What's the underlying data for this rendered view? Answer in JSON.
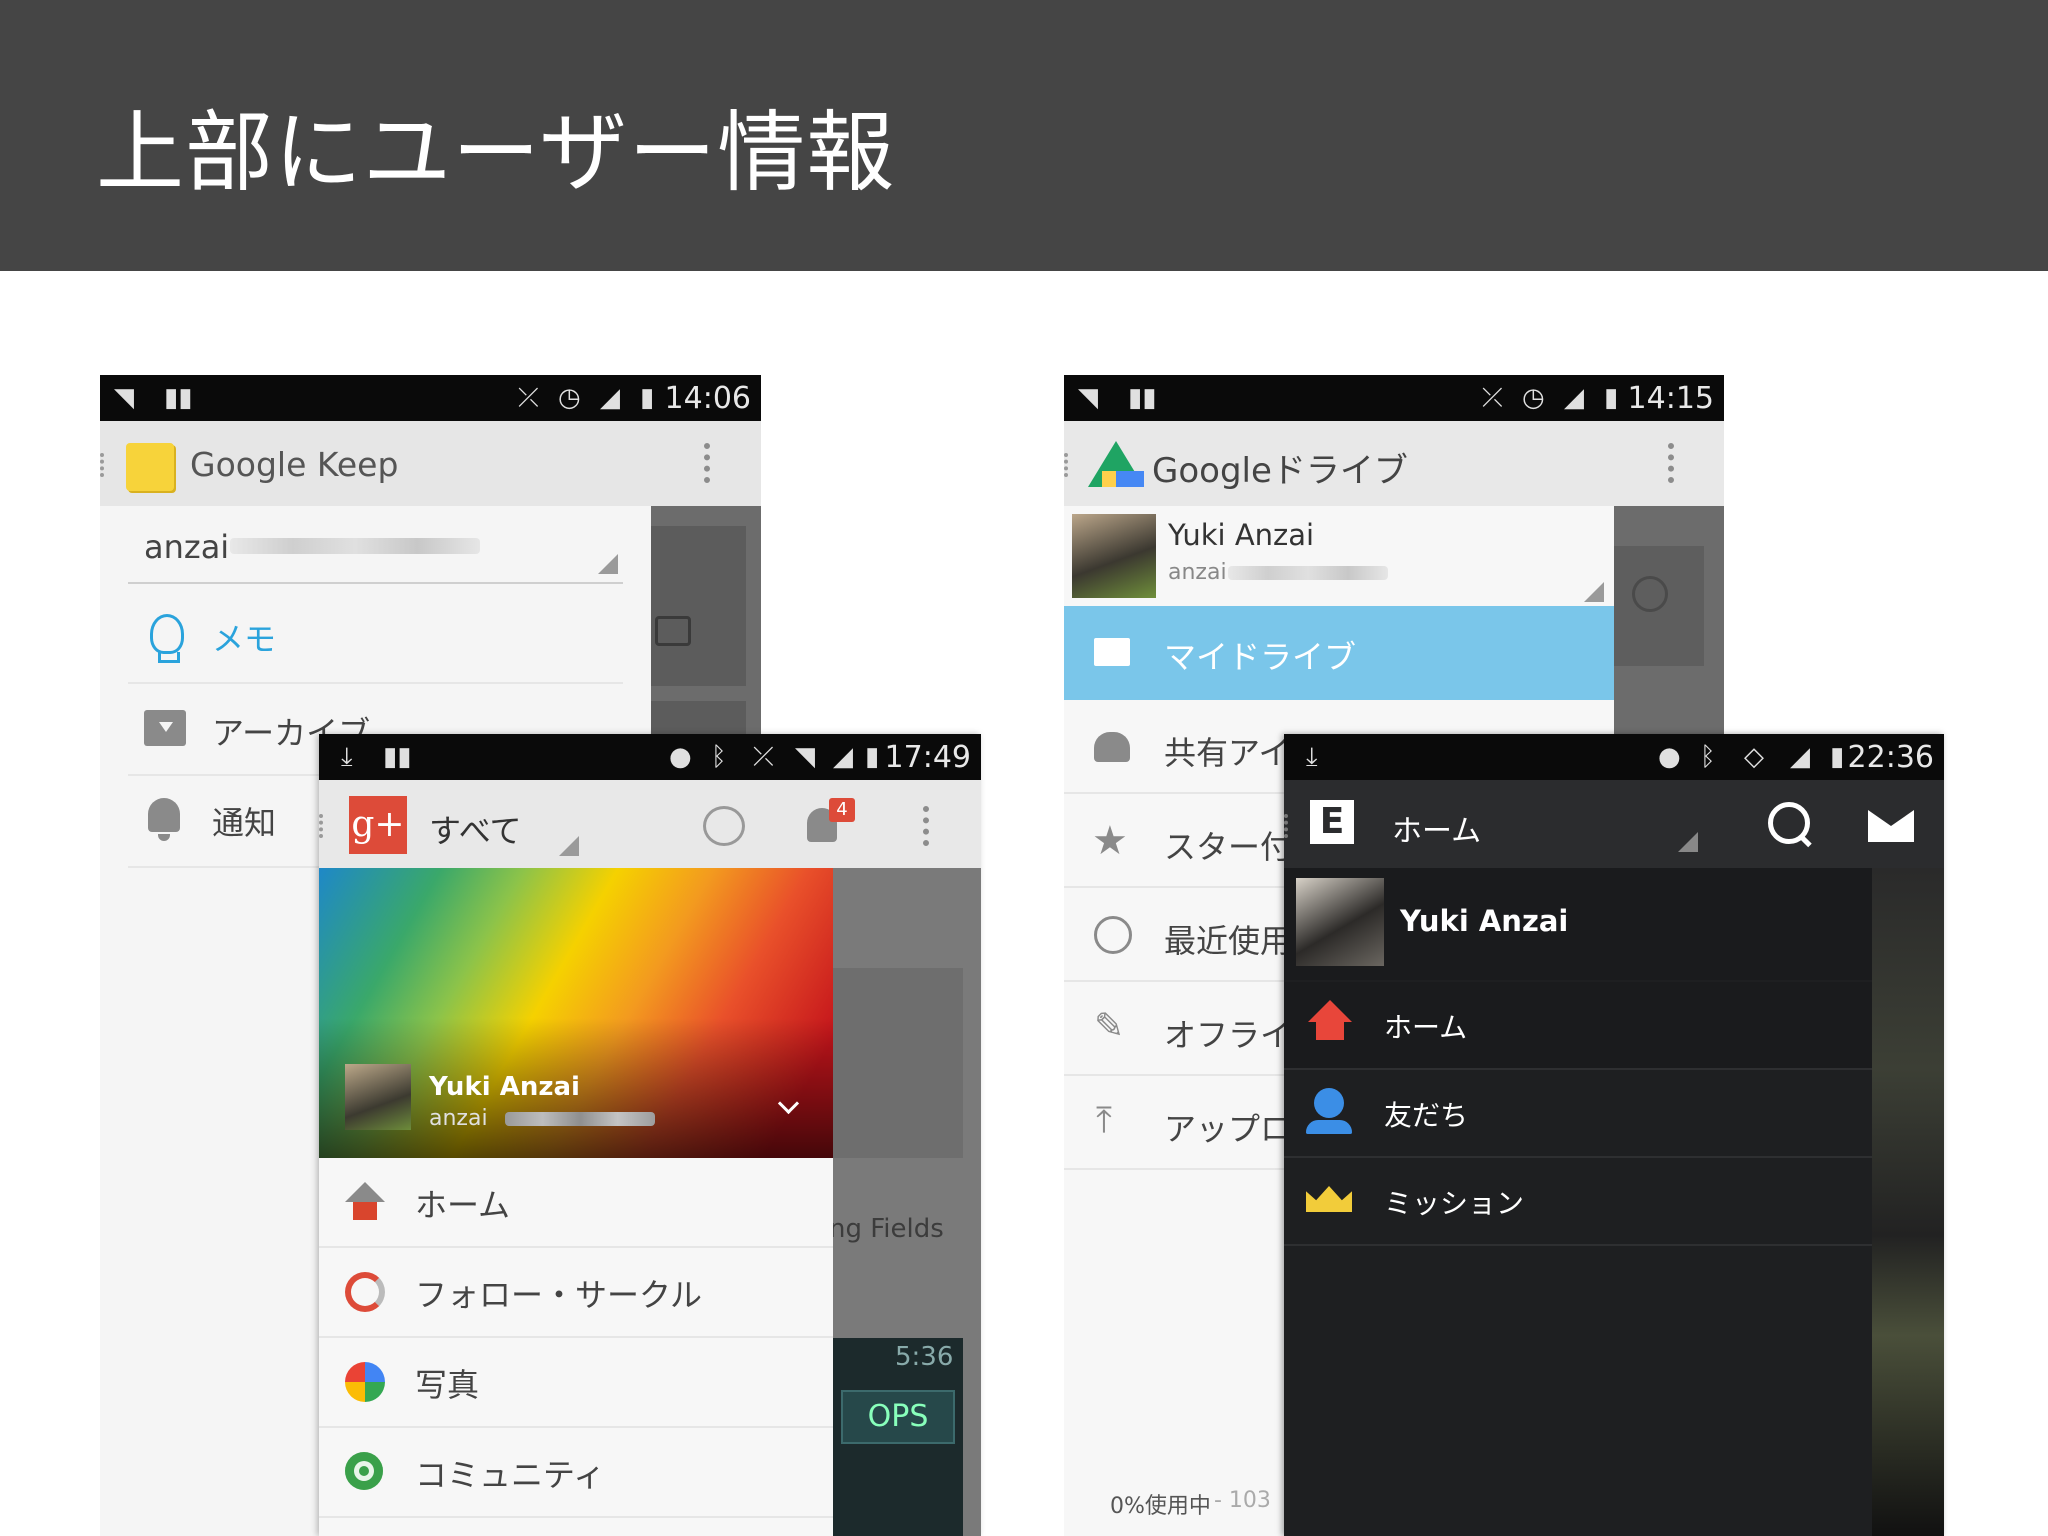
{
  "slide": {
    "title": "上部にユーザー情報"
  },
  "keep": {
    "time": "14:06",
    "app_title": "Google Keep",
    "account_name": "anzai",
    "menu": [
      "メモ",
      "アーカイブ",
      "通知"
    ]
  },
  "gplus": {
    "time": "17:49",
    "app_title": "すべて",
    "notification_count": "4",
    "user_name": "Yuki Anzai",
    "user_email": "anzai",
    "menu": [
      "ホーム",
      "フォロー・サークル",
      "写真",
      "コミュニティ"
    ],
    "behind_text": "ng Fields",
    "behind_time": "5:36",
    "behind_badge": "OPS"
  },
  "drive": {
    "time": "14:15",
    "app_title": "Googleドライブ",
    "user_name": "Yuki Anzai",
    "user_email": "anzai",
    "menu": [
      "マイドライブ",
      "共有アイ",
      "スター付",
      "最近使用",
      "オフライ",
      "アップロ"
    ],
    "storage": "0%使用中",
    "storage_extra": "- 103"
  },
  "evernote": {
    "time": "22:36",
    "app_title": "ホーム",
    "user_name": "Yuki Anzai",
    "menu": [
      "ホーム",
      "友だち",
      "ミッション"
    ]
  },
  "colors": {
    "header_bg": "#454545",
    "keep_accent": "#2aa3dc",
    "drive_selected": "#7ac6ea",
    "gplus_red": "#dd4b39",
    "evernote_bg": "#1e1f21"
  }
}
